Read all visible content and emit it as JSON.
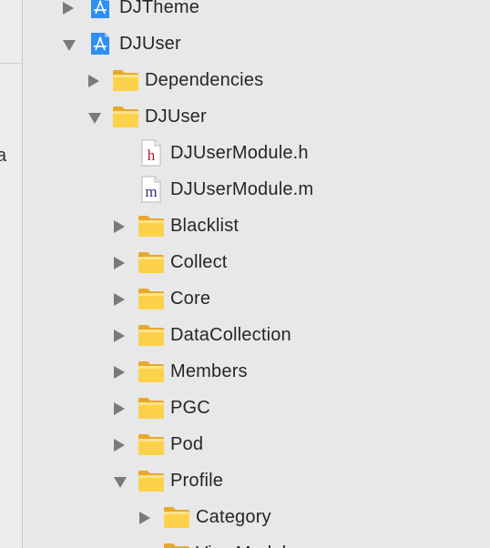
{
  "left_pane": {
    "partial_char": "a"
  },
  "tree": [
    {
      "label": "DJTheme",
      "icon": "xcode-project-icon",
      "expand": "closed"
    },
    {
      "label": "DJUser",
      "icon": "xcode-project-icon",
      "expand": "open"
    },
    {
      "label": "Dependencies",
      "icon": "folder-icon",
      "expand": "closed"
    },
    {
      "label": "DJUser",
      "icon": "folder-icon",
      "expand": "open"
    },
    {
      "label": "DJUserModule.h",
      "icon": "header-file-icon",
      "expand": "none"
    },
    {
      "label": "DJUserModule.m",
      "icon": "objc-file-icon",
      "expand": "none"
    },
    {
      "label": "Blacklist",
      "icon": "folder-icon",
      "expand": "closed"
    },
    {
      "label": "Collect",
      "icon": "folder-icon",
      "expand": "closed"
    },
    {
      "label": "Core",
      "icon": "folder-icon",
      "expand": "closed"
    },
    {
      "label": "DataCollection",
      "icon": "folder-icon",
      "expand": "closed"
    },
    {
      "label": "Members",
      "icon": "folder-icon",
      "expand": "closed"
    },
    {
      "label": "PGC",
      "icon": "folder-icon",
      "expand": "closed"
    },
    {
      "label": "Pod",
      "icon": "folder-icon",
      "expand": "closed"
    },
    {
      "label": "Profile",
      "icon": "folder-icon",
      "expand": "open"
    },
    {
      "label": "Category",
      "icon": "folder-icon",
      "expand": "closed"
    },
    {
      "label": "ViewModels",
      "icon": "folder-icon",
      "expand": "closed"
    }
  ]
}
